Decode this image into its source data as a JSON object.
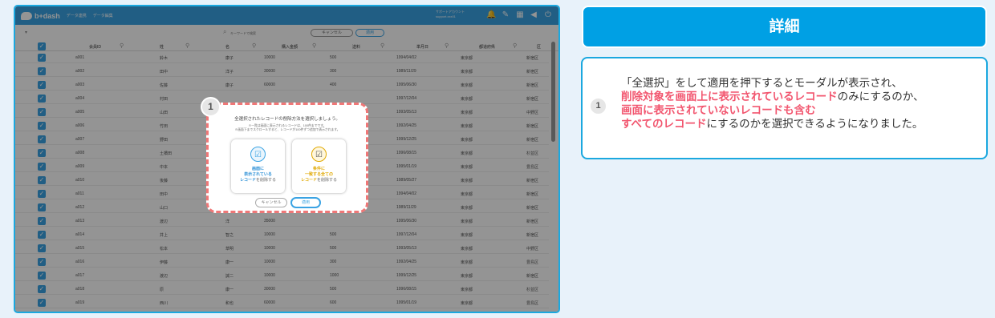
{
  "app": {
    "logo": "b+dash",
    "nav": [
      "データ連携",
      "データ編集"
    ],
    "account_lines": [
      "サポートアカウント",
      "support.xxx01"
    ]
  },
  "toolbar": {
    "search_placeholder": "キーワードで検索",
    "cancel_label": "キャンセル",
    "apply_label": "適用"
  },
  "table": {
    "columns": [
      "会員ID",
      "姓",
      "名",
      "購入金額",
      "送料",
      "単月日",
      "都道府県",
      "区"
    ],
    "rows": [
      [
        "a001",
        "鈴木",
        "康子",
        "10000",
        "500",
        "1994/04/02",
        "東京都",
        "新宿区"
      ],
      [
        "a002",
        "田中",
        "洋子",
        "30000",
        "300",
        "1989/11/29",
        "東京都",
        "新宿区"
      ],
      [
        "a003",
        "佐藤",
        "康子",
        "60000",
        "400",
        "1995/06/30",
        "東京都",
        "新宿区"
      ],
      [
        "a004",
        "村田",
        "",
        "",
        "",
        "1997/12/04",
        "東京都",
        "新宿区"
      ],
      [
        "a005",
        "山田",
        "",
        "",
        "",
        "1993/05/13",
        "東京都",
        "中野区"
      ],
      [
        "a006",
        "竹田",
        "",
        "",
        "",
        "1992/04/25",
        "東京都",
        "新宿区"
      ],
      [
        "a007",
        "野田",
        "",
        "",
        "",
        "1999/12/25",
        "東京都",
        "新宿区"
      ],
      [
        "a008",
        "土橋田",
        "",
        "",
        "",
        "1996/08/15",
        "東京都",
        "杉並区"
      ],
      [
        "a009",
        "中本",
        "",
        "",
        "",
        "1995/01/19",
        "東京都",
        "豊島区"
      ],
      [
        "a010",
        "後藤",
        "",
        "",
        "",
        "1989/05/27",
        "東京都",
        "新宿区"
      ],
      [
        "a011",
        "田中",
        "",
        "",
        "",
        "1994/04/02",
        "東京都",
        "新宿区"
      ],
      [
        "a012",
        "山口",
        "",
        "",
        "",
        "1989/11/29",
        "東京都",
        "新宿区"
      ],
      [
        "a013",
        "渡辺",
        "洋",
        "35000",
        "",
        "1995/06/30",
        "東京都",
        "新宿区"
      ],
      [
        "a014",
        "井上",
        "智之",
        "10000",
        "500",
        "1997/12/04",
        "東京都",
        "新宿区"
      ],
      [
        "a015",
        "松本",
        "草明",
        "10000",
        "500",
        "1993/05/13",
        "東京都",
        "中野区"
      ],
      [
        "a016",
        "伊藤",
        "康一",
        "10000",
        "300",
        "1992/04/25",
        "東京都",
        "豊島区"
      ],
      [
        "a017",
        "渡辺",
        "誠二",
        "10000",
        "1000",
        "1999/12/25",
        "東京都",
        "新宿区"
      ],
      [
        "a018",
        "原",
        "康一",
        "30000",
        "500",
        "1996/08/15",
        "東京都",
        "杉並区"
      ],
      [
        "a019",
        "西川",
        "和也",
        "60000",
        "600",
        "1995/01/19",
        "東京都",
        "豊島区"
      ]
    ]
  },
  "modal": {
    "title": "全選択されたレコードの削除方法を選択しましょう。",
    "desc_lines": [
      "※一覧は画面に表示されるレコードは、100件までです。",
      "※画面下までスクロールすると、レコードが100件ずつ追加で表示されます。"
    ],
    "option1": {
      "line1": "画面に",
      "line2": "表示されている",
      "line3_hl": "レコード",
      "line3_rest": "を削除する"
    },
    "option2": {
      "line1": "条件に",
      "line2": "一致する全ての",
      "line3_hl": "レコード",
      "line3_rest": "を削除する"
    },
    "cancel": "キャンセル",
    "apply": "適用"
  },
  "badge": "1",
  "detail": {
    "title": "詳細",
    "badge": "1",
    "line1": "「全選択」をして適用を押下するとモーダルが表示され、",
    "line2_hl": "削除対象を画面上に表示されているレコード",
    "line2_rest": "のみにするのか、",
    "line3_hl": "画面に表示されていないレコードも含む",
    "line4_hl": "すべてのレコード",
    "line4_rest": "にするのかを選択できるようになりました。"
  }
}
